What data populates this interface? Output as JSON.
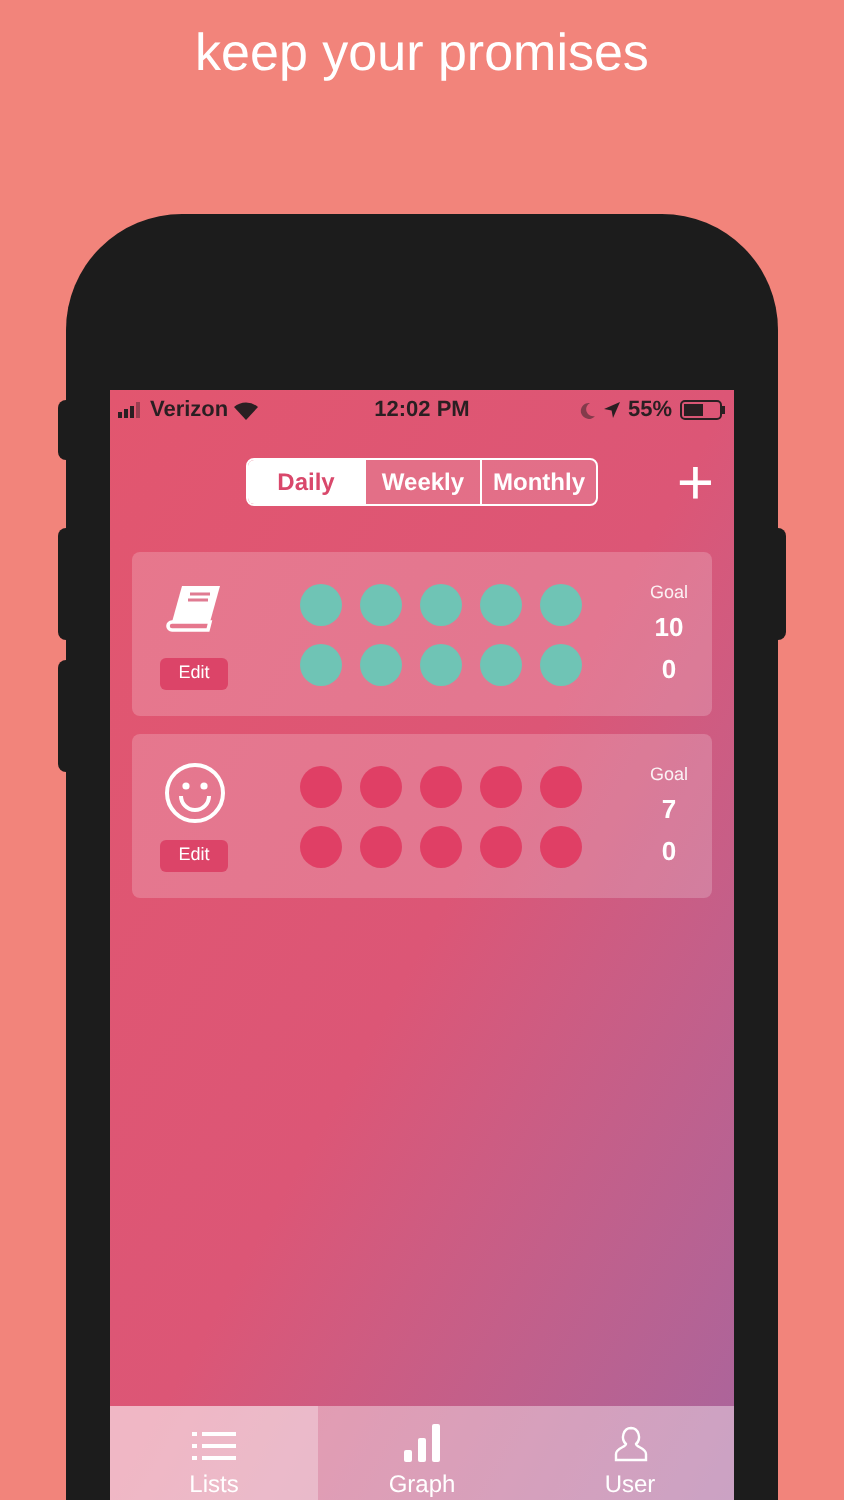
{
  "headline": "keep your promises",
  "status_bar": {
    "carrier": "Verizon",
    "time": "12:02 PM",
    "battery": "55%"
  },
  "period_tabs": [
    {
      "label": "Daily",
      "selected": true
    },
    {
      "label": "Weekly",
      "selected": false
    },
    {
      "label": "Monthly",
      "selected": false
    }
  ],
  "add_button": {
    "label": "+"
  },
  "habits": [
    {
      "kind": "book",
      "edit_label": "Edit",
      "color": "#6fc4b5",
      "goal_label": "Goal",
      "goal": "10",
      "count": "0"
    },
    {
      "kind": "smiley",
      "edit_label": "Edit",
      "color": "#e03f65",
      "goal_label": "Goal",
      "goal": "7",
      "count": "0"
    }
  ],
  "bottom_tabs": [
    {
      "kind": "list",
      "label": "Lists",
      "selected": true
    },
    {
      "kind": "bars",
      "label": "Graph",
      "selected": false
    },
    {
      "kind": "user",
      "label": "User",
      "selected": false
    }
  ]
}
